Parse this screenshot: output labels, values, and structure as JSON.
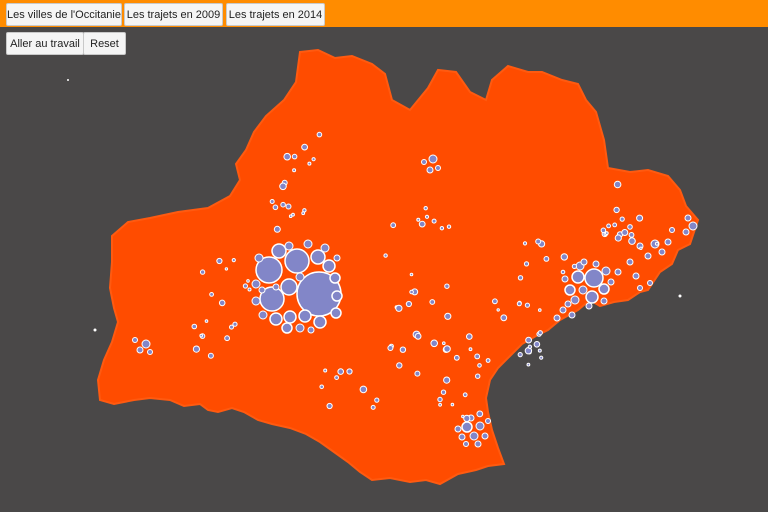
{
  "tabs": [
    {
      "label": "Les villes de l'Occitanie"
    },
    {
      "label": "Les trajets en 2009"
    },
    {
      "label": "Les trajets en 2014"
    }
  ],
  "actions": {
    "go_to_work": "Aller au travail",
    "reset": "Reset"
  },
  "colors": {
    "toolbar": "#ff8c00",
    "background": "#4a4848",
    "region_fill": "#ff4c00",
    "city_bubble": "#8286c8",
    "bubble_stroke": "#ffffff"
  }
}
